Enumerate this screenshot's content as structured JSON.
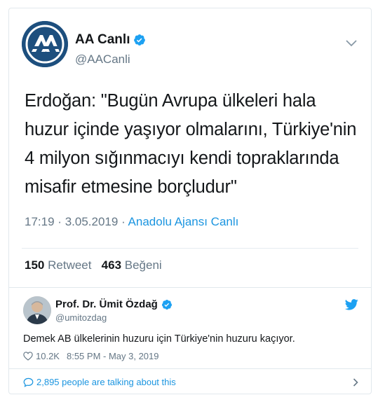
{
  "main_tweet": {
    "display_name": "AA Canlı",
    "handle": "@AACanli",
    "text": "Erdoğan: \"Bugün Avrupa ülkeleri hala huzur içinde yaşıyor olmalarını, Türkiye'nin 4 milyon sığınmacıyı kendi topraklarında misafir etmesine borçludur\"",
    "time": "17:19",
    "date": "3.05.2019",
    "separator": "·",
    "source": "Anadolu Ajansı Canlı",
    "retweet_count": "150",
    "retweet_label": "Retweet",
    "like_count": "463",
    "like_label": "Beğeni",
    "avatar_logo": "AA"
  },
  "quoted_tweet": {
    "display_name": "Prof. Dr. Ümit Özdağ",
    "handle": "@umitozdag",
    "text": "Demek AB ülkelerinin huzuru için Türkiye'nin huzuru kaçıyor.",
    "likes": "10.2K",
    "timestamp": "8:55 PM - May 3, 2019"
  },
  "footer": {
    "talking_text": "2,895 people are talking about this"
  },
  "icons": {
    "info": "info-icon",
    "verified": "verified-badge-icon",
    "caret": "chevron-down-icon",
    "bird": "twitter-bird-icon",
    "heart": "heart-icon",
    "bubble": "speech-bubble-icon",
    "chevron": "chevron-right-icon"
  },
  "colors": {
    "accent": "#1b95e0",
    "verified": "#1da1f2",
    "muted": "#657786",
    "text": "#14171a",
    "aa_blue": "#1d4f7e"
  }
}
